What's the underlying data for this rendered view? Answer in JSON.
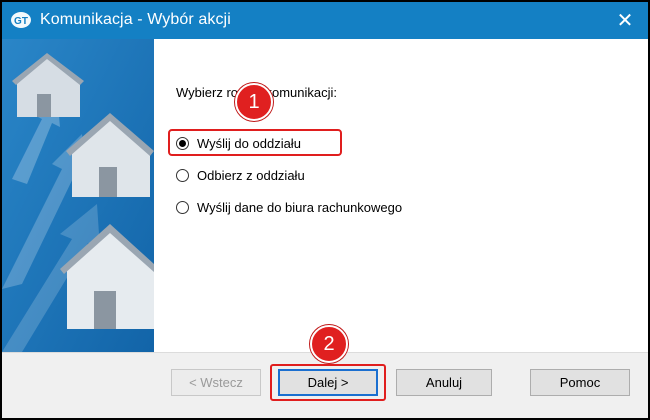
{
  "window": {
    "title": "Komunikacja - Wybór akcji",
    "close_glyph": "✕",
    "colors": {
      "titlebar": "#1480c4",
      "highlight": "#e01e1e",
      "badge": "#e02020"
    }
  },
  "content": {
    "prompt": "Wybierz rodzaj komunikacji:",
    "options": [
      {
        "label": "Wyślij do oddziału",
        "selected": true
      },
      {
        "label": "Odbierz z oddziału",
        "selected": false
      },
      {
        "label": "Wyślij dane do biura rachunkowego",
        "selected": false
      }
    ]
  },
  "annotations": {
    "badge1": "1",
    "badge2": "2"
  },
  "buttons": {
    "back": "< Wstecz",
    "next": "Dalej >",
    "cancel": "Anuluj",
    "help": "Pomoc"
  },
  "icons": {
    "app": "app-logo-icon",
    "close": "close-icon",
    "art": "houses-illustration"
  }
}
